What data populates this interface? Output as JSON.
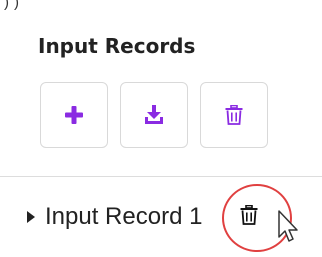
{
  "panel": {
    "title": "Input Records",
    "toolbar": [
      {
        "name": "add-record-button",
        "icon": "plus-icon",
        "color": "#8a2be2"
      },
      {
        "name": "download-record-button",
        "icon": "download-icon",
        "color": "#8a2be2"
      },
      {
        "name": "delete-records-button",
        "icon": "trash-icon",
        "color": "#8a2be2"
      }
    ]
  },
  "records": [
    {
      "label": "Input Record 1",
      "expanded": false,
      "action_icon": "trash-icon"
    }
  ],
  "annotation": {
    "color": "#e04040"
  },
  "cursor": {
    "icon": "mouse-pointer-icon"
  }
}
